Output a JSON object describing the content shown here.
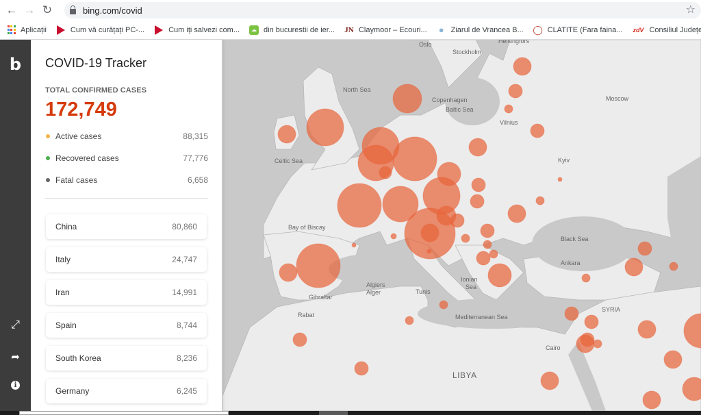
{
  "browser": {
    "url": "bing.com/covid",
    "nav": {
      "back_icon": "arrow-left-icon",
      "forward_icon": "arrow-right-icon",
      "reload_icon": "reload-icon",
      "bookmark_icon": "star-icon"
    },
    "bookmarks": [
      {
        "label": "Aplicații",
        "icon": "apps-grid-icon"
      },
      {
        "label": "Cum vă curățați PC-...",
        "icon": "red-play-icon"
      },
      {
        "label": "Cum iți salvezi com...",
        "icon": "red-play-icon"
      },
      {
        "label": "din bucurestii de ier...",
        "icon": "green-cloud-icon"
      },
      {
        "label": "Claymoor – Ecouri...",
        "icon": "jn-logo-icon"
      },
      {
        "label": "Ziarul de Vrancea B...",
        "icon": "person-icon"
      },
      {
        "label": "CLATITE (Fara faina...",
        "icon": "chef-hat-icon"
      },
      {
        "label": "Consiliul Județean t...",
        "icon": "zdv-logo-icon"
      }
    ]
  },
  "rail": {
    "logo": "b",
    "icons": [
      "bing-logo-icon",
      "expand-icon",
      "share-icon",
      "info-icon"
    ]
  },
  "tracker": {
    "title": "COVID-19 Tracker",
    "total_label": "TOTAL CONFIRMED CASES",
    "total_value": "172,749",
    "stats": [
      {
        "label": "Active cases",
        "value": "88,315",
        "color": "#f0b64a"
      },
      {
        "label": "Recovered cases",
        "value": "77,776",
        "color": "#4caf50"
      },
      {
        "label": "Fatal cases",
        "value": "6,658",
        "color": "#666666"
      }
    ],
    "countries": [
      {
        "name": "China",
        "count": "80,860"
      },
      {
        "name": "Italy",
        "count": "24,747"
      },
      {
        "name": "Iran",
        "count": "14,991"
      },
      {
        "name": "Spain",
        "count": "8,744"
      },
      {
        "name": "South Korea",
        "count": "8,236"
      },
      {
        "name": "Germany",
        "count": "6,245"
      }
    ]
  },
  "map": {
    "bubble_color": "#e8653b",
    "labels": {
      "oslo": "Oslo",
      "stockholm": "Stockholm",
      "helsingfors": "Helsingfors",
      "north_sea": "North Sea",
      "copenhagen": "Copenhagen",
      "baltic_sea": "Baltic Sea",
      "moscow": "Moscow",
      "vilnius": "Vilnius",
      "celtic_sea": "Celtic Sea",
      "kyiv": "Kyiv",
      "bay_of_biscay": "Bay of Biscay",
      "black_sea": "Black Sea",
      "ankara": "Ankara",
      "algiers": "Algiers",
      "alger": "Alger",
      "gibraltar": "Gibraltar",
      "tunis": "Tunis",
      "ionian": "Ionian",
      "sea": "Sea",
      "rabat": "Rabat",
      "mediterranean_sea": "Mediterranean Sea",
      "syria": "SYRIA",
      "cairo": "Cairo",
      "libya": "LIBYA"
    }
  }
}
